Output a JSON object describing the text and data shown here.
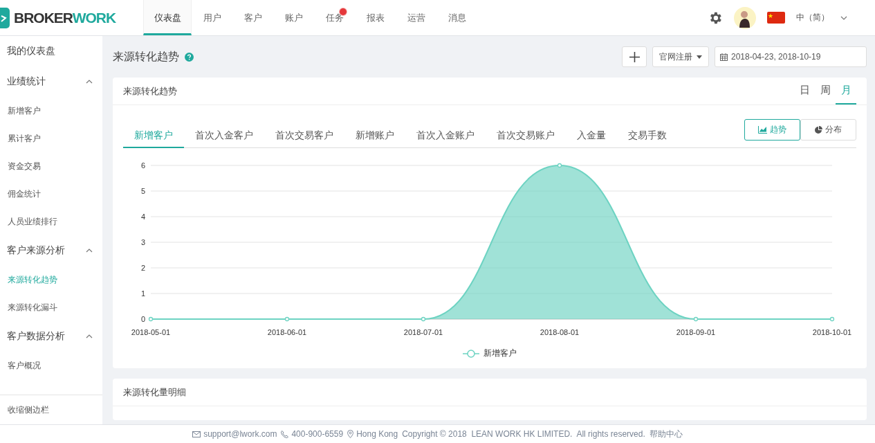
{
  "header": {
    "logo": {
      "part1": "BROKER",
      "part2": "WORK"
    },
    "nav": [
      {
        "label": "仪表盘",
        "selected": true,
        "badge": false
      },
      {
        "label": "用户",
        "selected": false,
        "badge": false
      },
      {
        "label": "客户",
        "selected": false,
        "badge": false
      },
      {
        "label": "账户",
        "selected": false,
        "badge": false
      },
      {
        "label": "任务",
        "selected": false,
        "badge": true
      },
      {
        "label": "报表",
        "selected": false,
        "badge": false
      },
      {
        "label": "运营",
        "selected": false,
        "badge": false
      },
      {
        "label": "消息",
        "selected": false,
        "badge": false
      }
    ],
    "language": "中（简）"
  },
  "sidebar": {
    "items": [
      {
        "label": "我的仪表盘",
        "selected": false
      },
      {
        "label": "业绩统计",
        "expanded": true,
        "children": [
          {
            "label": "新增客户",
            "selected": false
          },
          {
            "label": "累计客户",
            "selected": false
          },
          {
            "label": "资金交易",
            "selected": false
          },
          {
            "label": "佣金统计",
            "selected": false
          },
          {
            "label": "人员业绩排行",
            "selected": false
          }
        ]
      },
      {
        "label": "客户来源分析",
        "expanded": true,
        "children": [
          {
            "label": "来源转化趋势",
            "selected": true
          },
          {
            "label": "来源转化漏斗",
            "selected": false
          }
        ]
      },
      {
        "label": "客户数据分析",
        "expanded": true,
        "children": [
          {
            "label": "客户概况",
            "selected": false
          }
        ]
      }
    ],
    "collapse": "收缩侧边栏"
  },
  "page": {
    "title": "来源转化趋势",
    "source_select": "官网注册",
    "date_range": "2018-04-23, 2018-10-19"
  },
  "trend_card": {
    "title": "来源转化趋势",
    "periods": [
      {
        "label": "日",
        "selected": false
      },
      {
        "label": "周",
        "selected": false
      },
      {
        "label": "月",
        "selected": true
      }
    ],
    "metrics": [
      {
        "label": "新增客户",
        "selected": true
      },
      {
        "label": "首次入金客户",
        "selected": false
      },
      {
        "label": "首次交易客户",
        "selected": false
      },
      {
        "label": "新增账户",
        "selected": false
      },
      {
        "label": "首次入金账户",
        "selected": false
      },
      {
        "label": "首次交易账户",
        "selected": false
      },
      {
        "label": "入金量",
        "selected": false
      },
      {
        "label": "交易手数",
        "selected": false
      }
    ],
    "views": [
      {
        "label": "趋势",
        "kind": "trend",
        "selected": true
      },
      {
        "label": "分布",
        "kind": "pie",
        "selected": false
      }
    ],
    "chart_data": {
      "type": "area",
      "categories": [
        "2018-05-01",
        "2018-06-01",
        "2018-07-01",
        "2018-08-01",
        "2018-09-01",
        "2018-10-01"
      ],
      "series": [
        {
          "name": "新增客户",
          "color": "#6dd3c2",
          "values": [
            0,
            0,
            0,
            6,
            0,
            0
          ]
        }
      ],
      "ylim": [
        0,
        6
      ],
      "yticks": [
        0,
        1,
        2,
        3,
        4,
        5,
        6
      ],
      "grid": true
    }
  },
  "detail_card": {
    "title": "来源转化量明细"
  },
  "footer": {
    "email": "support@lwork.com",
    "phone": "400-900-6559",
    "location": "Hong Kong",
    "copyright": "Copyright © 2018  LEAN WORK HK LIMITED.  All rights reserved.",
    "help": "帮助中心"
  }
}
